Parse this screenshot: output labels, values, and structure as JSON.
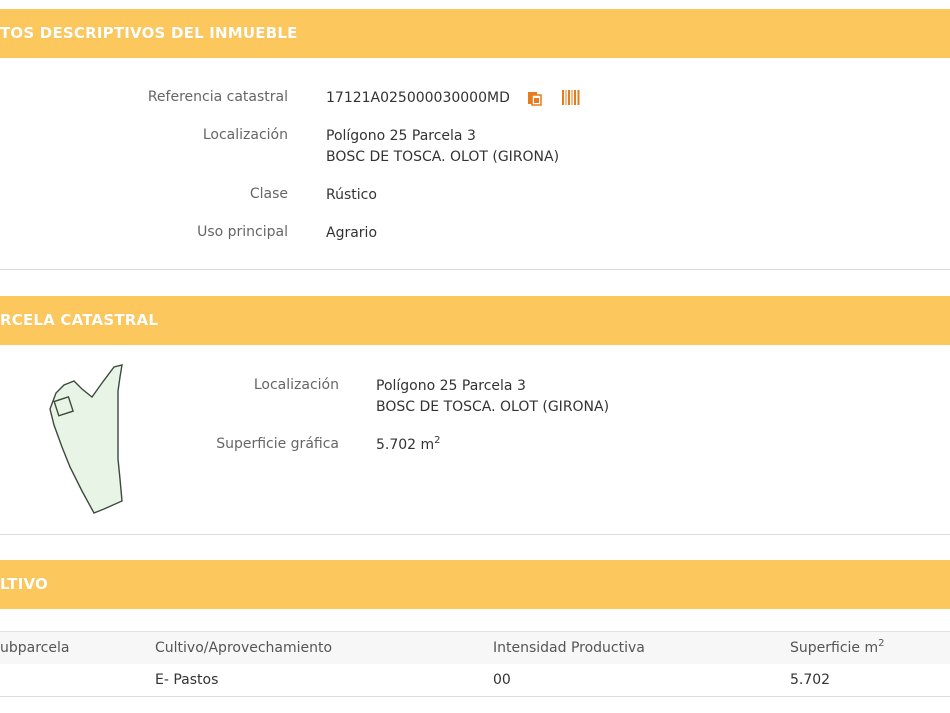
{
  "section1": {
    "title": "TOS DESCRIPTIVOS DEL INMUEBLE",
    "fields": {
      "ref_label": "Referencia catastral",
      "ref_value": "17121A025000030000MD",
      "loc_label": "Localización",
      "loc_line1": "Polígono 25 Parcela 3",
      "loc_line2": "BOSC DE TOSCA. OLOT (GIRONA)",
      "clase_label": "Clase",
      "clase_value": "Rústico",
      "uso_label": "Uso principal",
      "uso_value": "Agrario"
    },
    "icons": [
      "copy-icon",
      "barcode-icon"
    ]
  },
  "section2": {
    "title": "RCELA CATASTRAL",
    "fields": {
      "loc_label": "Localización",
      "loc_line1": "Polígono 25 Parcela 3",
      "loc_line2": "BOSC DE TOSCA. OLOT (GIRONA)",
      "sup_label": "Superficie gráfica",
      "sup_value": "5.702 m",
      "sup_unit_exp": "2"
    }
  },
  "section3": {
    "title": "LTIVO",
    "table": {
      "headers": [
        "ubparcela",
        "Cultivo/Aprovechamiento",
        "Intensidad Productiva",
        "Superficie m"
      ],
      "header_superscript": "2",
      "rows": [
        [
          "",
          "E- Pastos",
          "00",
          "5.702"
        ]
      ]
    }
  },
  "colors": {
    "header_bg": "#fcc75c",
    "icon_orange": "#e87b1c",
    "parcel_fill": "#e8f5e6"
  }
}
